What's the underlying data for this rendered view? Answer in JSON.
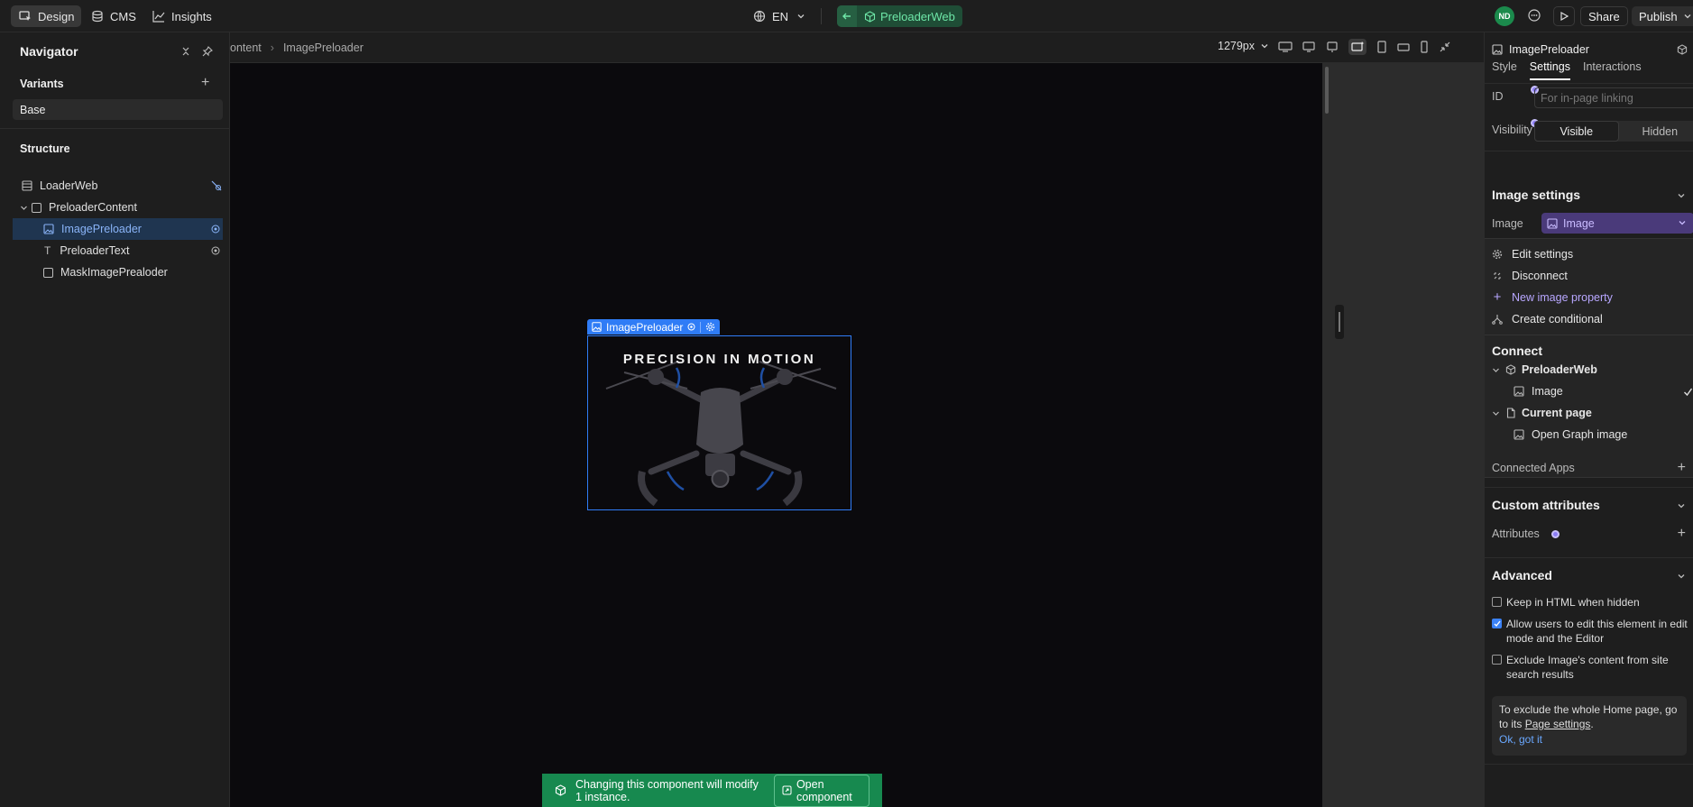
{
  "topbar": {
    "tabs": [
      {
        "label": "Design",
        "icon": "design-icon"
      },
      {
        "label": "CMS",
        "icon": "database-icon"
      },
      {
        "label": "Insights",
        "icon": "chart-icon"
      }
    ],
    "language": "EN",
    "component_name": "PreloaderWeb",
    "avatar_initials": "ND",
    "share_label": "Share",
    "publish_label": "Publish"
  },
  "navigator": {
    "title": "Navigator",
    "variants_title": "Variants",
    "base_variant": "Base",
    "structure_title": "Structure",
    "tree": [
      {
        "label": "LoaderWeb"
      },
      {
        "label": "PreloaderContent"
      },
      {
        "label": "ImagePreloader"
      },
      {
        "label": "PreloaderText"
      },
      {
        "label": "MaskImagePrealoder"
      }
    ]
  },
  "canvas": {
    "breadcrumb": [
      "ontent",
      "ImagePreloader"
    ],
    "width_label": "1279px",
    "selection_label": "ImagePreloader",
    "hero_text": "PRECISION IN MOTION",
    "toast_text": "Changing this component will modify 1 instance.",
    "toast_button": "Open component"
  },
  "panel": {
    "element_name": "ImagePreloader",
    "tabs": [
      "Style",
      "Settings",
      "Interactions"
    ],
    "active_tab": "Settings",
    "id_label": "ID",
    "id_placeholder": "For in-page linking",
    "visibility_label": "Visibility",
    "visible_label": "Visible",
    "hidden_label": "Hidden",
    "image_settings_title": "Image settings",
    "image_label": "Image",
    "image_value": "Image",
    "menu": [
      "Edit settings",
      "Disconnect",
      "New image property",
      "Create conditional"
    ],
    "connect_title": "Connect",
    "connect_tree": [
      "PreloaderWeb",
      "Image",
      "Current page",
      "Open Graph image"
    ],
    "connected_apps": "Connected Apps",
    "custom_attributes_title": "Custom attributes",
    "attributes_label": "Attributes",
    "advanced_title": "Advanced",
    "advanced_options": [
      {
        "label": "Keep in HTML when hidden",
        "checked": false
      },
      {
        "label": "Allow users to edit this element in edit mode and the Editor",
        "checked": true
      },
      {
        "label": "Exclude Image's content from site search results",
        "checked": false
      }
    ],
    "info_text_before": "To exclude the whole Home page, go to its ",
    "info_link": "Page settings",
    "info_text_after": ".",
    "info_ok": "Ok, got it"
  },
  "colors": {
    "accent": "#3b82f6",
    "component_green": "#1f6f47",
    "toast_green": "#17894f",
    "selection_blue": "#2f7cf6",
    "purple": "#a78bfa"
  }
}
